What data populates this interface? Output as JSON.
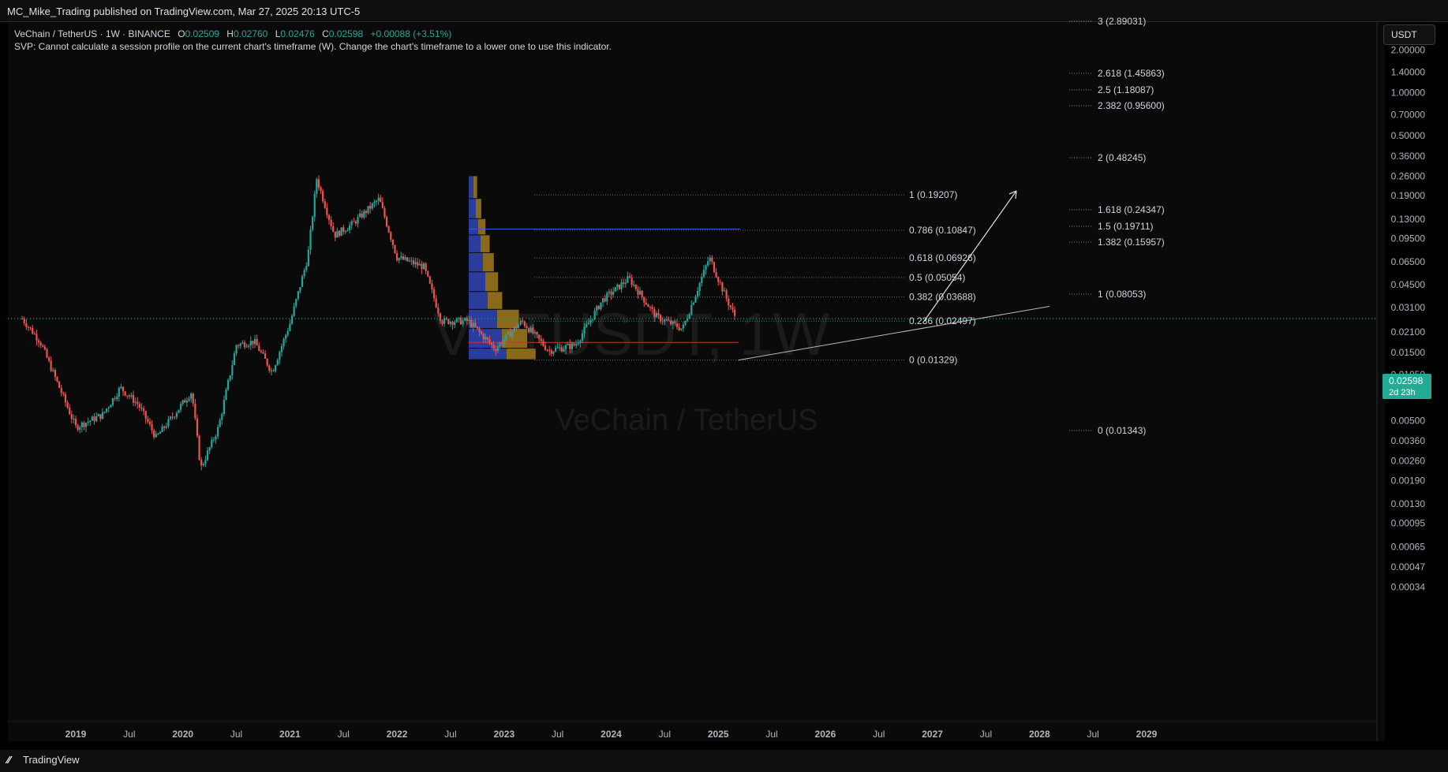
{
  "header": {
    "published": "MC_Mike_Trading published on TradingView.com, Mar 27, 2025 20:13 UTC-5"
  },
  "legend": {
    "symbol": "VeChain / TetherUS · 1W · BINANCE",
    "open_label": "O",
    "open": "0.02509",
    "high_label": "H",
    "high": "0.02760",
    "low_label": "L",
    "low": "0.02476",
    "close_label": "C",
    "close": "0.02598",
    "change": "+0.00088 (+3.51%)",
    "svp_note": "SVP: Cannot calculate a session profile on the current chart's timeframe (W). Change the chart's timeframe to a lower one to use this indicator."
  },
  "currency_button": "USDT",
  "price_badge": {
    "price": "0.02598",
    "countdown": "2d 23h"
  },
  "watermark": {
    "symbol": "VETUSDT, 1W",
    "name": "VeChain / TetherUS"
  },
  "footer": {
    "brand": "TradingView"
  },
  "colors": {
    "up": "#26a69a",
    "down": "#ef5350",
    "profile_blue": "#2a3d9c",
    "profile_orange": "#8a6a1a",
    "fib_line": "#888888"
  },
  "chart_data": {
    "type": "candlestick",
    "scale": "log",
    "ylim": [
      0.0003,
      2.3
    ],
    "y_tick_labels": [
      "2.00000",
      "1.40000",
      "1.00000",
      "0.70000",
      "0.50000",
      "0.36000",
      "0.26000",
      "0.19000",
      "0.13000",
      "0.09500",
      "0.06500",
      "0.04500",
      "0.03100",
      "0.02100",
      "0.01500",
      "0.01050",
      "0.00750",
      "0.00500",
      "0.00360",
      "0.00260",
      "0.00190",
      "0.00130",
      "0.00095",
      "0.00065",
      "0.00047",
      "0.00034"
    ],
    "x_tick_labels": [
      "2019",
      "Jul",
      "2020",
      "Jul",
      "2021",
      "Jul",
      "2022",
      "Jul",
      "2023",
      "Jul",
      "2024",
      "Jul",
      "2025",
      "Jul",
      "2026",
      "Jul",
      "2027",
      "Jul",
      "2028",
      "Jul",
      "2029"
    ],
    "x_range": [
      "2018-07",
      "2029-12"
    ],
    "fib_retracement": [
      {
        "level": "1",
        "value": "(0.19207)"
      },
      {
        "level": "0.786",
        "value": "(0.10847)"
      },
      {
        "level": "0.618",
        "value": "(0.06926)"
      },
      {
        "level": "0.5",
        "value": "(0.05054)"
      },
      {
        "level": "0.382",
        "value": "(0.03688)"
      },
      {
        "level": "0.236",
        "value": "(0.02497)"
      },
      {
        "level": "0",
        "value": "(0.01329)"
      }
    ],
    "fib_extension": [
      {
        "level": "3",
        "value": "(2.89031)"
      },
      {
        "level": "2.618",
        "value": "(1.45863)"
      },
      {
        "level": "2.5",
        "value": "(1.18087)"
      },
      {
        "level": "2.382",
        "value": "(0.95600)"
      },
      {
        "level": "2",
        "value": "(0.48245)"
      },
      {
        "level": "1.618",
        "value": "(0.24347)"
      },
      {
        "level": "1.5",
        "value": "(0.19711)"
      },
      {
        "level": "1.382",
        "value": "(0.15957)"
      },
      {
        "level": "1",
        "value": "(0.08053)"
      },
      {
        "level": "0",
        "value": "(0.01343)"
      }
    ],
    "price_path": [
      [
        "2018-07",
        0.026
      ],
      [
        "2018-09",
        0.018
      ],
      [
        "2018-11",
        0.009
      ],
      [
        "2019-01",
        0.0045
      ],
      [
        "2019-04",
        0.0055
      ],
      [
        "2019-06",
        0.0085
      ],
      [
        "2019-08",
        0.0065
      ],
      [
        "2019-10",
        0.0038
      ],
      [
        "2019-12",
        0.0055
      ],
      [
        "2020-02",
        0.008
      ],
      [
        "2020-03",
        0.0023
      ],
      [
        "2020-05",
        0.0045
      ],
      [
        "2020-07",
        0.017
      ],
      [
        "2020-09",
        0.018
      ],
      [
        "2020-11",
        0.011
      ],
      [
        "2021-01",
        0.024
      ],
      [
        "2021-03",
        0.07
      ],
      [
        "2021-04",
        0.25
      ],
      [
        "2021-06",
        0.1
      ],
      [
        "2021-08",
        0.12
      ],
      [
        "2021-11",
        0.18
      ],
      [
        "2022-01",
        0.07
      ],
      [
        "2022-04",
        0.06
      ],
      [
        "2022-06",
        0.025
      ],
      [
        "2022-09",
        0.025
      ],
      [
        "2022-12",
        0.016
      ],
      [
        "2023-03",
        0.025
      ],
      [
        "2023-06",
        0.0155
      ],
      [
        "2023-09",
        0.017
      ],
      [
        "2023-12",
        0.035
      ],
      [
        "2024-03",
        0.05
      ],
      [
        "2024-06",
        0.027
      ],
      [
        "2024-09",
        0.022
      ],
      [
        "2024-12",
        0.07
      ],
      [
        "2025-02",
        0.035
      ],
      [
        "2025-03",
        0.026
      ]
    ],
    "last_price": 0.02598
  }
}
